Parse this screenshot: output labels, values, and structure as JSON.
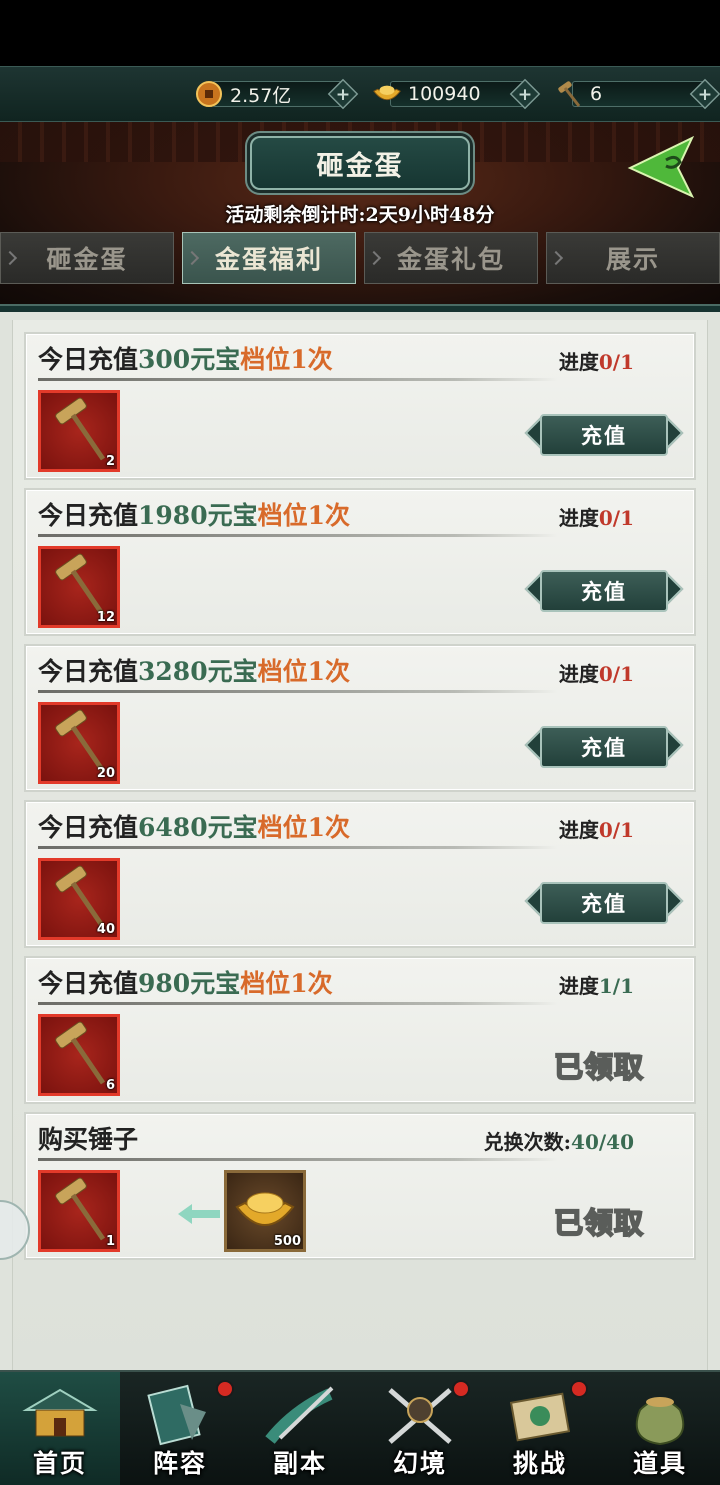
{
  "resources": [
    {
      "icon": "copper-coin-icon",
      "value": "2.57亿"
    },
    {
      "icon": "gold-ingot-icon",
      "value": "100940"
    },
    {
      "icon": "hammer-icon",
      "value": "6"
    }
  ],
  "header": {
    "title": "砸金蛋",
    "countdown": "活动剩余倒计时:2天9小时48分"
  },
  "tabs": [
    {
      "label": "砸金蛋",
      "active": false
    },
    {
      "label": "金蛋福利",
      "active": true
    },
    {
      "label": "金蛋礼包",
      "active": false
    },
    {
      "label": "展示",
      "active": false
    }
  ],
  "cards": [
    {
      "prefix": "今日充值",
      "amount": "300元宝",
      "suffix": "档位1次",
      "progress_label": "进度",
      "progress_value": "0/1",
      "item_count": "2",
      "button": "充值"
    },
    {
      "prefix": "今日充值",
      "amount": "1980元宝",
      "suffix": "档位1次",
      "progress_label": "进度",
      "progress_value": "0/1",
      "item_count": "12",
      "button": "充值"
    },
    {
      "prefix": "今日充值",
      "amount": "3280元宝",
      "suffix": "档位1次",
      "progress_label": "进度",
      "progress_value": "0/1",
      "item_count": "20",
      "button": "充值"
    },
    {
      "prefix": "今日充值",
      "amount": "6480元宝",
      "suffix": "档位1次",
      "progress_label": "进度",
      "progress_value": "0/1",
      "item_count": "40",
      "button": "充值"
    },
    {
      "prefix": "今日充值",
      "amount": "980元宝",
      "suffix": "档位1次",
      "progress_label": "进度",
      "progress_value": "1/1",
      "item_count": "6",
      "status": "已领取"
    }
  ],
  "purchase": {
    "title": "购买锤子",
    "exchange_label": "兑换次数:",
    "exchange_value": "40/40",
    "item_count": "1",
    "cost_count": "500",
    "status": "已领取"
  },
  "nav": [
    {
      "label": "首页",
      "badge": false
    },
    {
      "label": "阵容",
      "badge": true
    },
    {
      "label": "副本",
      "badge": false
    },
    {
      "label": "幻境",
      "badge": true
    },
    {
      "label": "挑战",
      "badge": true
    },
    {
      "label": "道具",
      "badge": false
    }
  ],
  "colors": {
    "accent_green": "#3a6b52",
    "accent_orange": "#d86a2a",
    "item_red": "#a8251c",
    "badge_red": "#d62a22"
  }
}
